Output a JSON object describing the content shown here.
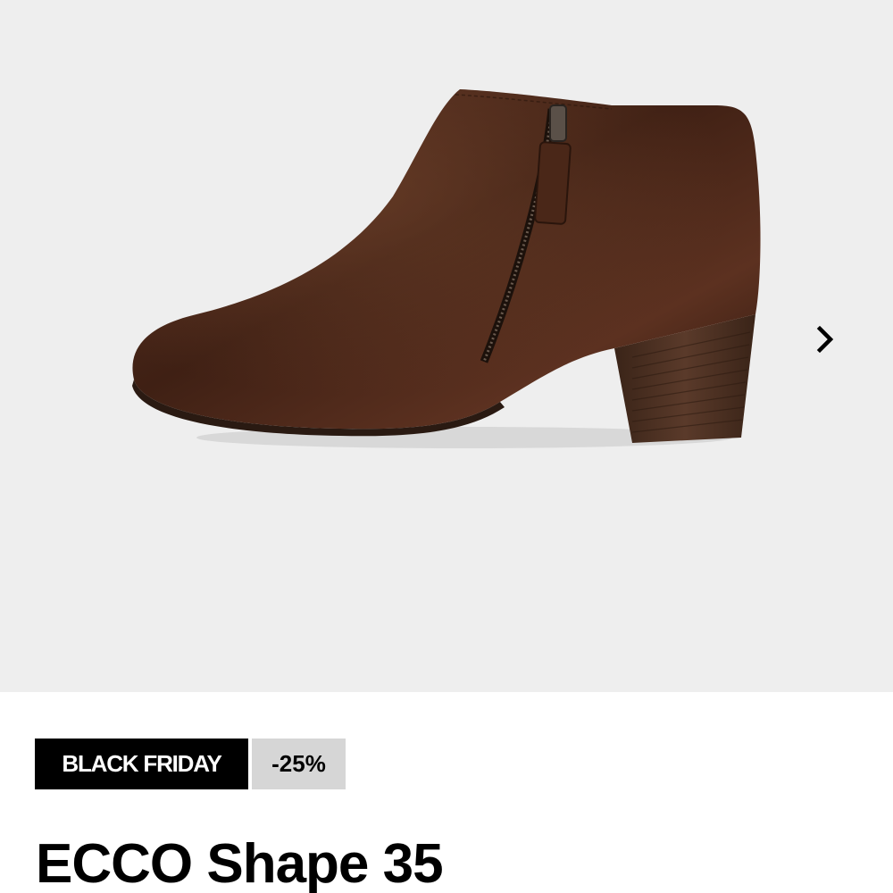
{
  "gallery": {
    "image_alt": "ECCO Shape 35 brown leather ankle boot",
    "next_icon": "chevron-right-icon"
  },
  "badges": {
    "promo": "BLACK FRIDAY",
    "discount": "-25%"
  },
  "product": {
    "title": "ECCO Shape 35"
  },
  "colors": {
    "gallery_bg": "#eeeeee",
    "promo_bg": "#000000",
    "discount_bg": "#d6d6d6",
    "leather": "#4a2618"
  }
}
